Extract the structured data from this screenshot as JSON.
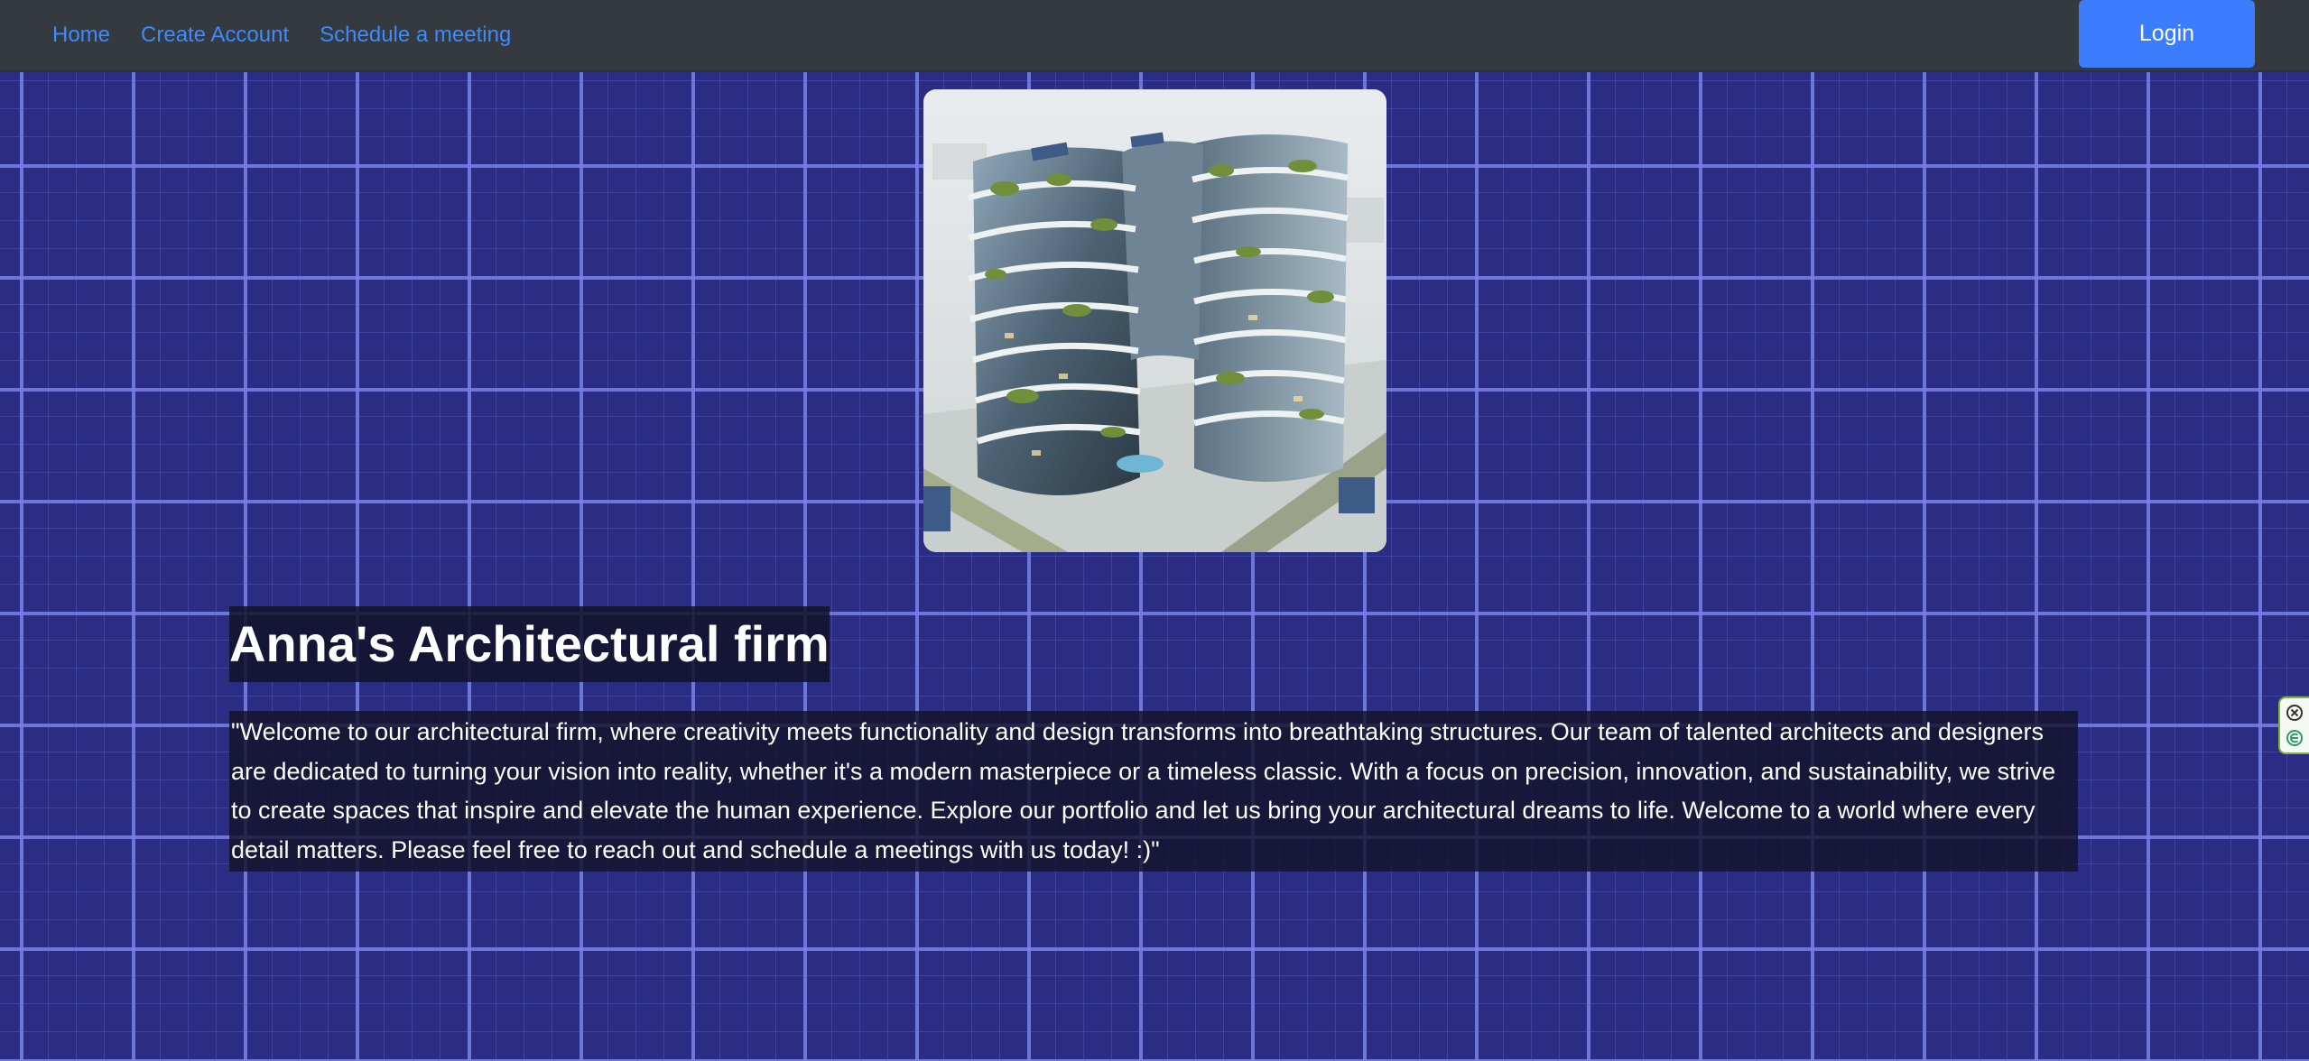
{
  "nav": {
    "links": [
      "Home",
      "Create Account",
      "Schedule a meeting"
    ],
    "login_label": "Login"
  },
  "hero": {
    "image_subject": "futuristic-green-terraced-building-render"
  },
  "main": {
    "title": "Anna's Architectural firm",
    "description": "\"Welcome to our architectural firm, where creativity meets functionality and design transforms into breathtaking structures. Our team of talented architects and designers are dedicated to turning your vision into reality, whether it's a modern masterpiece or a timeless classic. With a focus on precision, innovation, and sustainability, we strive to create spaces that inspire and elevate the human experience. Explore our portfolio and let us bring your architectural dreams to life. Welcome to a world where every detail matters. Please feel free to reach out and schedule a meetings with us today! :)\""
  },
  "extension_widget": {
    "icons": [
      "close-circle-icon",
      "extension-e-icon"
    ]
  },
  "colors": {
    "navbar_bg": "#343a40",
    "nav_link": "#3d8bfd",
    "login_bg": "#3c7dff",
    "page_bg": "#2b2d85",
    "grid_line": "#7882e6"
  }
}
